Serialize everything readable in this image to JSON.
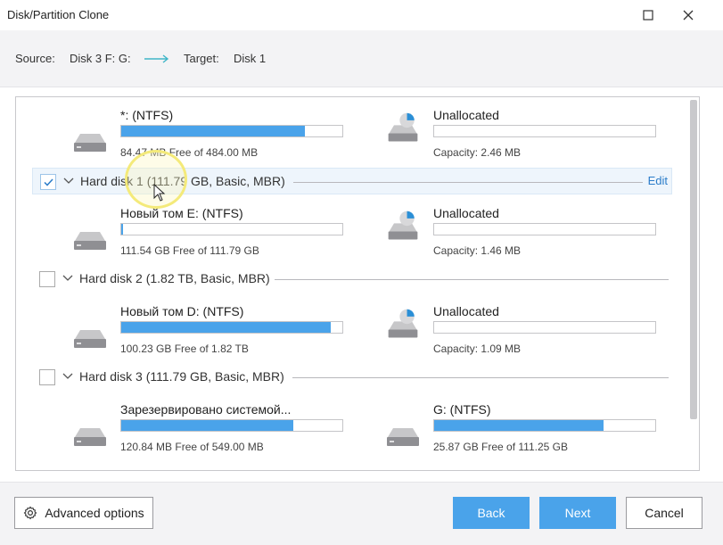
{
  "window": {
    "title": "Disk/Partition Clone"
  },
  "header": {
    "source_label": "Source:",
    "source_value": "Disk 3 F: G:",
    "target_label": "Target:",
    "target_value": "Disk 1"
  },
  "partitions_top": {
    "left": {
      "name": "*: (NTFS)",
      "info": "84.47 MB Free of 484.00 MB",
      "used_fraction": 0.83
    },
    "right": {
      "name": "Unallocated",
      "info": "Capacity: 2.46 MB",
      "used_fraction": 0
    }
  },
  "disks": [
    {
      "label": "Hard disk 1 (111.79 GB, Basic, MBR)",
      "checked": true,
      "edit_label": "Edit",
      "left": {
        "name": "Новый том E: (NTFS)",
        "info": "111.54 GB Free of 111.79 GB",
        "used_fraction": 0.004
      },
      "right": {
        "name": "Unallocated",
        "info": "Capacity: 1.46 MB",
        "used_fraction": 0
      }
    },
    {
      "label": "Hard disk 2 (1.82 TB, Basic, MBR)",
      "checked": false,
      "left": {
        "name": "Новый том D: (NTFS)",
        "info": "100.23 GB Free of 1.82 TB",
        "used_fraction": 0.946
      },
      "right": {
        "name": "Unallocated",
        "info": "Capacity: 1.09 MB",
        "used_fraction": 0
      }
    },
    {
      "label": "Hard disk 3 (111.79 GB, Basic, MBR)",
      "checked": false,
      "left": {
        "name": "Зарезервировано системой...",
        "info": "120.84 MB Free of 549.00 MB",
        "used_fraction": 0.78
      },
      "right": {
        "name": "G: (NTFS)",
        "info": "25.87 GB Free of 111.25 GB",
        "used_fraction": 0.768
      }
    }
  ],
  "footer": {
    "advanced_label": "Advanced options",
    "back_label": "Back",
    "next_label": "Next",
    "cancel_label": "Cancel"
  },
  "colors": {
    "accent": "#4aa3ea",
    "link": "#2b7cc9",
    "arrow": "#3fb6c8"
  }
}
